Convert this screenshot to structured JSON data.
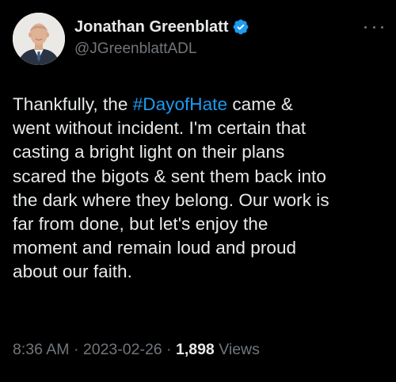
{
  "author": {
    "display_name": "Jonathan Greenblatt",
    "handle": "@JGreenblattADL",
    "verified_icon": "verified-badge-icon",
    "verified_color": "#1d9bf0"
  },
  "more_icon": "more-horizontal-icon",
  "tweet": {
    "lines": [
      {
        "before": "Thankfully, the ",
        "hashtag": "#DayofHate",
        "after": " came &"
      },
      {
        "text": "went without incident. I'm certain that"
      },
      {
        "text": "casting a bright light on their plans"
      },
      {
        "text": "scared the bigots & sent them back into"
      },
      {
        "text": "the dark where they belong. Our work is"
      },
      {
        "text": "far from done, but let's enjoy the"
      },
      {
        "text": "moment and remain loud and proud"
      },
      {
        "text": "about our faith."
      }
    ]
  },
  "meta": {
    "time": "8:36 AM",
    "separator": " · ",
    "date": "2023-02-26",
    "views_count": "1,898",
    "views_label": " Views"
  },
  "colors": {
    "background": "#000000",
    "text": "#e7e9ea",
    "secondary": "#71767b",
    "link": "#1d9bf0"
  }
}
